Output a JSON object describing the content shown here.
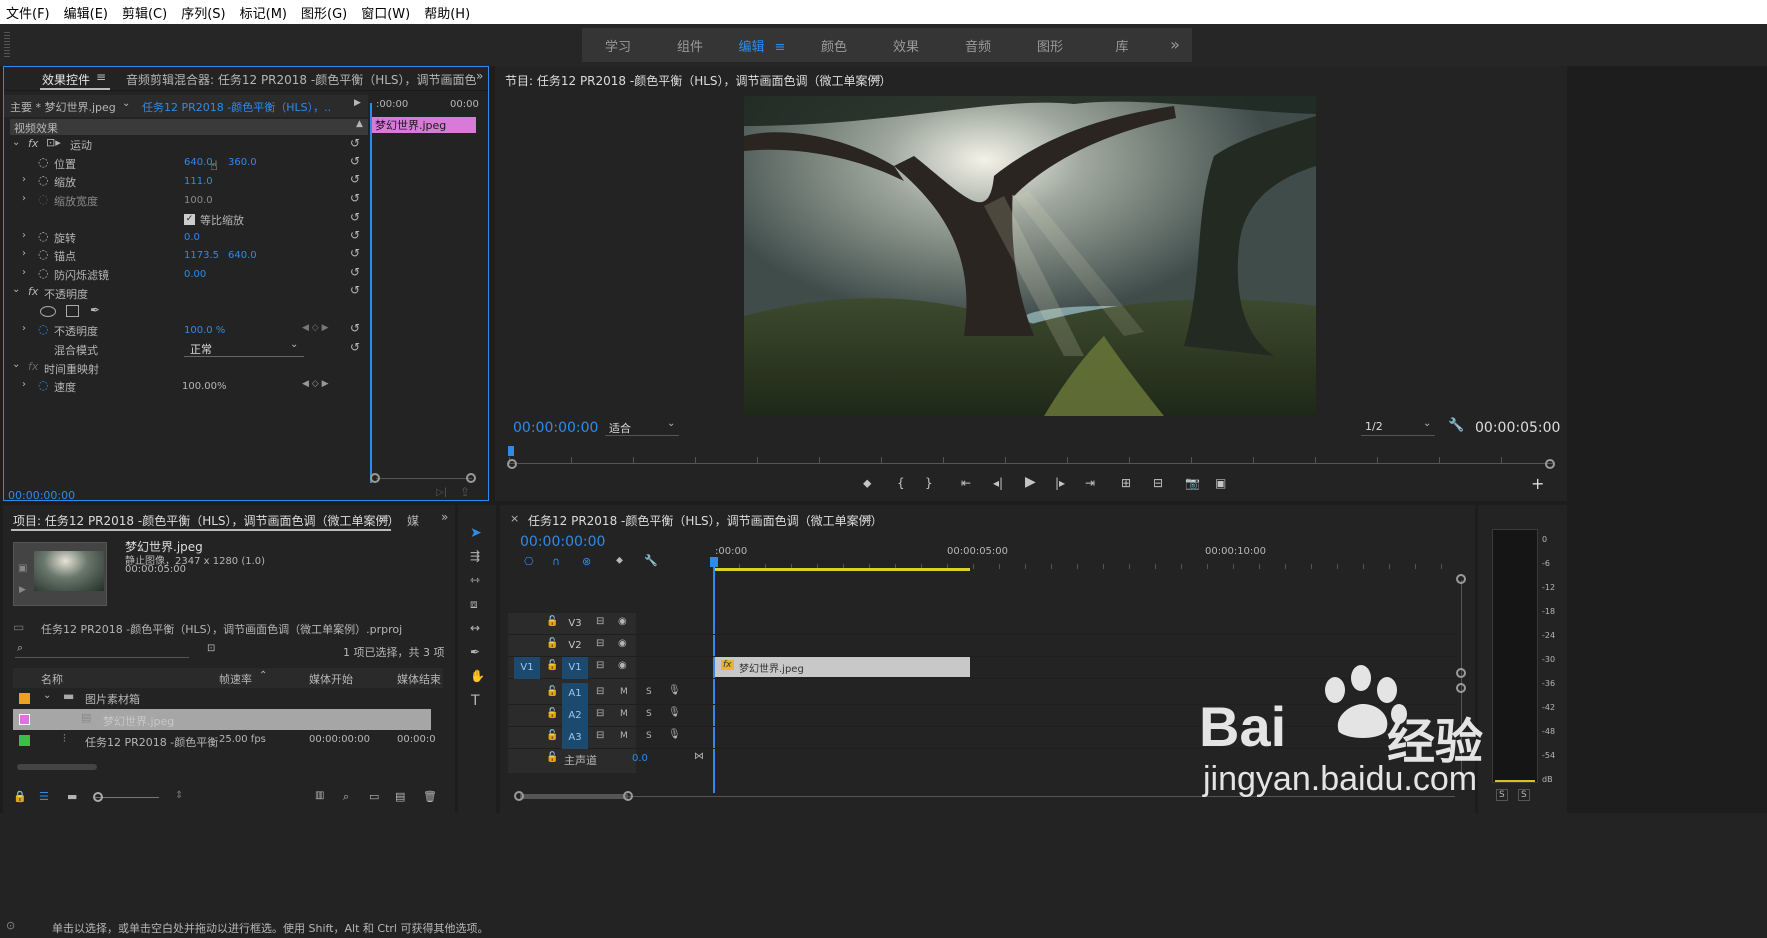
{
  "menu": [
    "文件(F)",
    "编辑(E)",
    "剪辑(C)",
    "序列(S)",
    "标记(M)",
    "图形(G)",
    "窗口(W)",
    "帮助(H)"
  ],
  "workspaces": [
    {
      "label": "学习"
    },
    {
      "label": "组件"
    },
    {
      "label": "编辑"
    },
    {
      "label": "颜色"
    },
    {
      "label": "效果"
    },
    {
      "label": "音频"
    },
    {
      "label": "图形"
    },
    {
      "label": "库"
    }
  ],
  "effect_controls": {
    "tab_active": "效果控件",
    "tab_other": "音频剪辑混合器: 任务12  PR2018 -颜色平衡（HLS），调节画面色",
    "master_label": "主要 * 梦幻世界.jpeg",
    "sequence_link": "任务12  PR2018 -颜色平衡（HLS），..",
    "ruler_start": ":00:00",
    "ruler_end": "00:00",
    "clip_name": "梦幻世界.jpeg",
    "section": "视频效果",
    "motion": "运动",
    "position_label": "位置",
    "position_x": "640.0",
    "position_y": "360.0",
    "scale_label": "缩放",
    "scale_value": "111.0",
    "scale_width_label": "缩放宽度",
    "scale_width_value": "100.0",
    "uniform_scale": "等比缩放",
    "rotation_label": "旋转",
    "rotation_value": "0.0",
    "anchor_label": "锚点",
    "anchor_x": "1173.5",
    "anchor_y": "640.0",
    "flicker_label": "防闪烁滤镜",
    "flicker_value": "0.00",
    "opacity_group": "不透明度",
    "opacity_label": "不透明度",
    "opacity_value": "100.0 %",
    "blend_label": "混合模式",
    "blend_value": "正常",
    "time_remap": "时间重映射",
    "speed_label": "速度",
    "speed_value": "100.00%",
    "timecode": "00:00:00:00"
  },
  "program": {
    "title": "节目: 任务12  PR2018 -颜色平衡（HLS），调节画面色调（微工单案例）",
    "timecode": "00:00:00:00",
    "fit": "适合",
    "resolution": "1/2",
    "duration": "00:00:05:00"
  },
  "project": {
    "title": "项目: 任务12  PR2018 -颜色平衡（HLS），调节画面色调（微工单案例）",
    "tab2": "媒",
    "clip_name": "梦幻世界.jpeg",
    "clip_type": "静止图像，2347 x 1280 (1.0)",
    "clip_duration": "00:00:05:00",
    "project_file": "任务12  PR2018 -颜色平衡（HLS），调节画面色调（微工单案例）.prproj",
    "selection_info": "1 项已选择，共 3 项",
    "columns": [
      "名称",
      "帧速率",
      "媒体开始",
      "媒体结束"
    ],
    "rows": [
      {
        "name": "图片素材箱",
        "fps": "",
        "start": "",
        "end": ""
      },
      {
        "name": "梦幻世界.jpeg",
        "fps": "",
        "start": "",
        "end": ""
      },
      {
        "name": "任务12  PR2018 -颜色平衡",
        "fps": "25.00 fps",
        "start": "00:00:00:00",
        "end": "00:00:0"
      }
    ]
  },
  "timeline": {
    "title": "任务12  PR2018 -颜色平衡（HLS），调节画面色调（微工单案例）",
    "timecode": "00:00:00:00",
    "ruler": [
      ":00:00",
      "00:00:05:00",
      "00:00:10:00"
    ],
    "video_tracks": [
      "V3",
      "V2",
      "V1"
    ],
    "audio_tracks": [
      "A1",
      "A2",
      "A3"
    ],
    "source_v": "V1",
    "master_label": "主声道",
    "master_value": "0.0",
    "clip_label": "梦幻世界.jpeg",
    "m": "M",
    "s": "S"
  },
  "meter": {
    "scale": [
      "0",
      "-6",
      "-12",
      "-18",
      "-24",
      "-30",
      "-36",
      "-42",
      "-48",
      "-54",
      "dB"
    ],
    "s_label": "S"
  },
  "status": "单击以选择，或单击空白处并拖动以进行框选。使用 Shift，Alt 和 Ctrl 可获得其他选项。",
  "watermark": {
    "brand": "Bai",
    "brand2": "经验",
    "url": "jingyan.baidu.com"
  }
}
